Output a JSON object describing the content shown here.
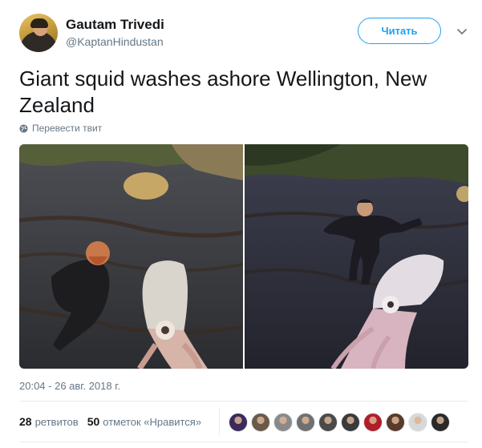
{
  "author": {
    "display_name": "Gautam Trivedi",
    "handle": "@KaptanHindustan"
  },
  "follow_button": {
    "label": "Читать"
  },
  "tweet": {
    "text": "Giant squid washes ashore Wellington, New Zealand",
    "translate_label": "Перевести твит",
    "timestamp": "20:04 - 26 авг. 2018 г."
  },
  "stats": {
    "retweets_count": "28",
    "retweets_label": "ретвитов",
    "likes_count": "50",
    "likes_label": "отметок «Нравится»"
  },
  "likers": [
    {
      "color": "#3b2a5a"
    },
    {
      "color": "#6a5a4a"
    },
    {
      "color": "#8a8a8a"
    },
    {
      "color": "#707070"
    },
    {
      "color": "#4a4a4a"
    },
    {
      "color": "#3a3a3a"
    },
    {
      "color": "#b01e2a"
    },
    {
      "color": "#5a3a2a"
    },
    {
      "color": "#d8d8d8"
    },
    {
      "color": "#2a2a2a"
    }
  ],
  "colors": {
    "accent": "#1da1f2",
    "secondary_text": "#657786"
  }
}
